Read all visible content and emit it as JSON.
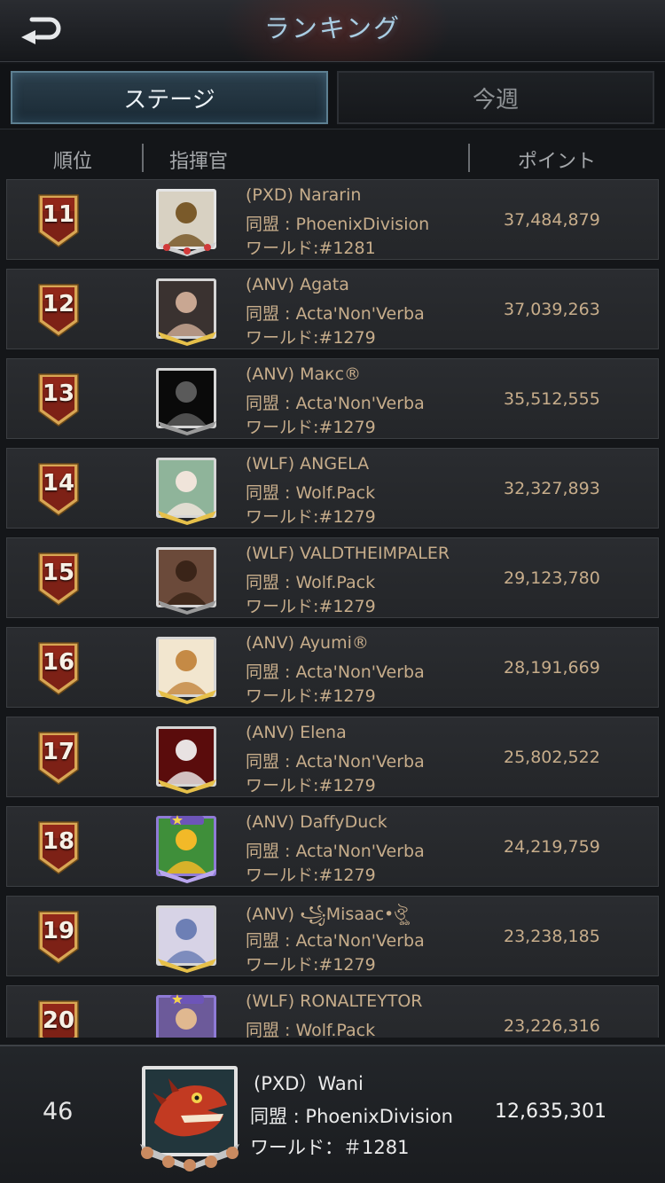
{
  "header": {
    "title": "ランキング",
    "back_icon": "back-arrow-icon"
  },
  "tabs": [
    {
      "label": "ステージ",
      "active": true
    },
    {
      "label": "今週",
      "active": false
    }
  ],
  "columns": {
    "rank": "順位",
    "commander": "指揮官",
    "points": "ポイント"
  },
  "rows": [
    {
      "rank": "11",
      "name": "(PXD) Nararin",
      "alliance": "同盟 : PhoenixDivision",
      "world": "ワールド:#1281",
      "points": "37,484,879",
      "avatar_bg": "#d8d1c2",
      "avatar_fg": "#7a5a2a",
      "frame": "red"
    },
    {
      "rank": "12",
      "name": "(ANV) Agata",
      "alliance": "同盟 : Acta'Non'Verba",
      "world": "ワールド:#1279",
      "points": "37,039,263",
      "avatar_bg": "#3a3230",
      "avatar_fg": "#c9a792",
      "frame": "gold"
    },
    {
      "rank": "13",
      "name": "(ANV) Макс®",
      "alliance": "同盟 : Acta'Non'Verba",
      "world": "ワールド:#1279",
      "points": "35,512,555",
      "avatar_bg": "#0a0a0a",
      "avatar_fg": "#5a5a5a",
      "frame": "dark"
    },
    {
      "rank": "14",
      "name": "(WLF) ANGELA",
      "alliance": "同盟 : Wolf.Pack",
      "world": "ワールド:#1279",
      "points": "32,327,893",
      "avatar_bg": "#8fb49a",
      "avatar_fg": "#f0e4da",
      "frame": "gold"
    },
    {
      "rank": "15",
      "name": "(WLF) VALDTHEIMPALER",
      "alliance": "同盟 : Wolf.Pack",
      "world": "ワールド:#1279",
      "points": "29,123,780",
      "avatar_bg": "#6b4a3a",
      "avatar_fg": "#3a2418",
      "frame": "dark"
    },
    {
      "rank": "16",
      "name": "(ANV) Ayumi®",
      "alliance": "同盟 : Acta'Non'Verba",
      "world": "ワールド:#1279",
      "points": "28,191,669",
      "avatar_bg": "#f2e6cf",
      "avatar_fg": "#c58a45",
      "frame": "gold"
    },
    {
      "rank": "17",
      "name": "(ANV) Elena",
      "alliance": "同盟 : Acta'Non'Verba",
      "world": "ワールド:#1279",
      "points": "25,802,522",
      "avatar_bg": "#5a0c0c",
      "avatar_fg": "#e8e2e2",
      "frame": "gold"
    },
    {
      "rank": "18",
      "name": "(ANV) DaffyDuck",
      "alliance": "同盟 : Acta'Non'Verba",
      "world": "ワールド:#1279",
      "points": "24,219,759",
      "avatar_bg": "#3f8f3a",
      "avatar_fg": "#f2b928",
      "frame": "star"
    },
    {
      "rank": "19",
      "name": "(ANV) ꧁Misaac•ঔৣ",
      "alliance": "同盟 : Acta'Non'Verba",
      "world": "ワールド:#1279",
      "points": "23,238,185",
      "avatar_bg": "#d7d3e6",
      "avatar_fg": "#6d7fb5",
      "frame": "gold"
    },
    {
      "rank": "20",
      "name": "(WLF) RONALTEYTOR",
      "alliance": "同盟 : Wolf.Pack",
      "world": "",
      "points": "23,226,316",
      "avatar_bg": "#6c5a9a",
      "avatar_fg": "#e0b890",
      "frame": "star"
    }
  ],
  "me": {
    "rank": "46",
    "name": "(PXD）Wani",
    "alliance": "同盟 : PhoenixDivision",
    "world": "ワールド：＃1281",
    "points": "12,635,301"
  },
  "colors": {
    "accent_text": "#c7ad8b",
    "badge_red": "#7d2116",
    "badge_gold": "#d8a654",
    "title_blue": "#a9cde3"
  }
}
